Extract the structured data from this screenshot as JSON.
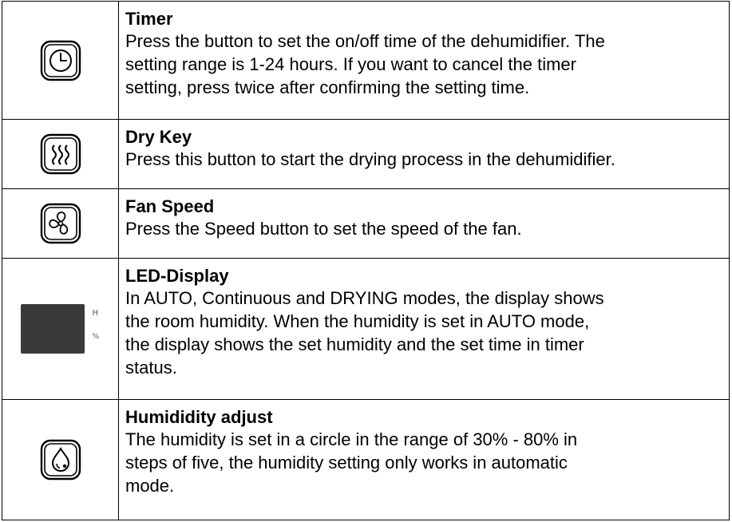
{
  "rows": [
    {
      "icon": "clock-icon",
      "title": "Timer",
      "lines": [
        "Press the button to set the on/off time of the dehumidifier. The",
        "setting range is 1-24 hours. If you want to cancel the timer",
        "setting, press twice after confirming the setting time."
      ]
    },
    {
      "icon": "heat-waves-icon",
      "title": "Dry Key",
      "lines": [
        "Press this button to start the drying process in the dehumidifier."
      ]
    },
    {
      "icon": "fan-icon",
      "title": "Fan Speed",
      "lines": [
        "Press the Speed button to set the speed of the fan."
      ]
    },
    {
      "icon": "led-display-icon",
      "title": "LED-Display",
      "display_labels": [
        "H",
        "%"
      ],
      "lines": [
        "In AUTO, Continuous and DRYING modes, the display shows",
        "the room humidity. When the humidity is set in AUTO mode,",
        "the display shows the set humidity and the set time in timer",
        "status."
      ]
    },
    {
      "icon": "water-drop-icon",
      "title": "Humididity adjust",
      "lines": [
        "The humidity is set in a circle in the range of 30% - 80% in",
        "steps of five, the humidity setting only works in automatic",
        "mode."
      ]
    }
  ]
}
